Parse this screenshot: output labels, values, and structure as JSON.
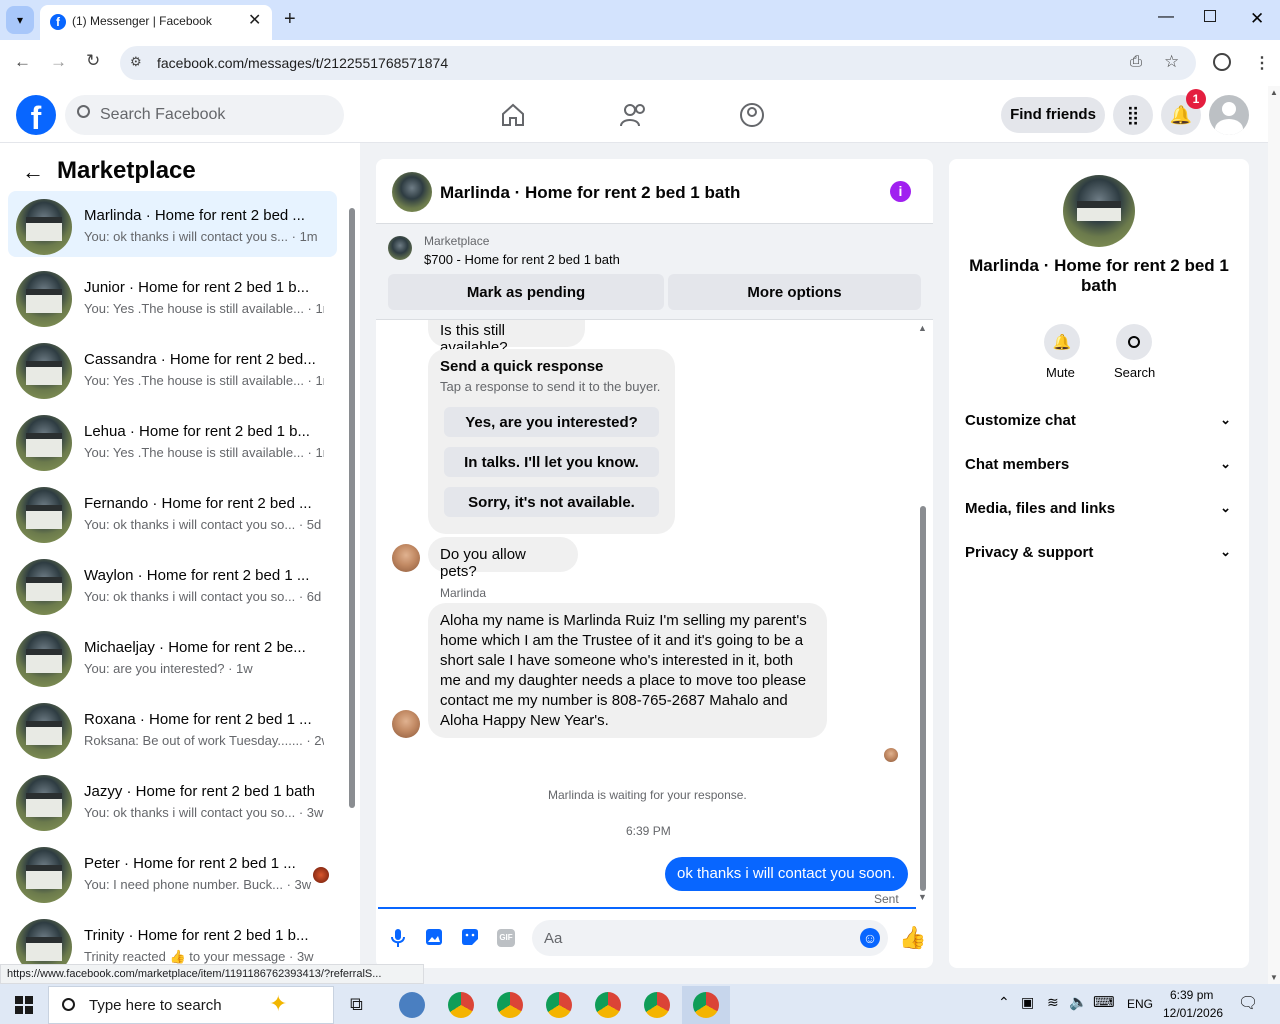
{
  "browser": {
    "tab_title": "(1) Messenger | Facebook",
    "url": "facebook.com/messages/t/2122551768571874",
    "status_url": "https://www.facebook.com/marketplace/item/1191186762393413/?referralS..."
  },
  "header": {
    "search_placeholder": "Search Facebook",
    "find_friends": "Find friends",
    "notif_count": "1"
  },
  "left": {
    "title": "Marketplace",
    "rows": [
      {
        "name": "Marlinda · Home for rent 2 bed ...",
        "sub": "You: ok thanks i will contact you s... · 1m"
      },
      {
        "name": "Junior · Home for rent 2 bed 1 b...",
        "sub": "You: Yes .The house is still available... · 1m"
      },
      {
        "name": "Cassandra · Home for rent 2 bed...",
        "sub": "You: Yes .The house is still available... · 1m"
      },
      {
        "name": "Lehua · Home for rent 2 bed 1 b...",
        "sub": "You: Yes .The house is still available... · 1m"
      },
      {
        "name": "Fernando · Home for rent 2 bed ...",
        "sub": "You: ok thanks i will contact you so... · 5d"
      },
      {
        "name": "Waylon · Home for rent 2 bed 1 ...",
        "sub": "You: ok thanks i will contact you so... · 6d"
      },
      {
        "name": "Michaeljay · Home for rent 2 be...",
        "sub": "You: are you interested? · 1w"
      },
      {
        "name": "Roxana · Home for rent 2 bed 1 ...",
        "sub": "Roksana: Be out of work Tuesday....... · 2w"
      },
      {
        "name": "Jazyy · Home for rent 2 bed 1 bath",
        "sub": "You: ok thanks i will contact you so... · 3w"
      },
      {
        "name": "Peter · Home for rent 2 bed 1 ...",
        "sub": "You: I need phone number. Buck... · 3w"
      },
      {
        "name": "Trinity · Home for rent 2 bed 1 b...",
        "sub": "Trinity reacted 👍 to your message · 3w"
      }
    ]
  },
  "chat": {
    "title": "Marlinda · Home for rent 2 bed 1 bath",
    "listing_source": "Marketplace",
    "listing_desc": "$700 - Home for rent 2 bed 1 bath",
    "mark_pending": "Mark as pending",
    "more_options": "More options",
    "msg_available": "Is this still available?",
    "quick_title": "Send a quick response",
    "quick_sub": "Tap a response to send it to the buyer.",
    "quick_1": "Yes, are you interested?",
    "quick_2": "In talks. I'll let you know.",
    "quick_3": "Sorry, it's not available.",
    "msg_pets": "Do you allow pets?",
    "sender": "Marlinda",
    "msg_long": "Aloha my name is Marlinda Ruiz I'm selling my parent's home which I am the Trustee of it and it's going to be a short sale I have someone who's interested in it,  both me and my daughter needs a place to move too please contact me my number is 808-765-2687 Mahalo and Aloha Happy New Year's.",
    "waiting": "Marlinda is waiting for your response.",
    "time": "6:39 PM",
    "my_msg": "ok thanks i will contact you soon.",
    "sent": "Sent",
    "input_placeholder": "Aa"
  },
  "right": {
    "title": "Marlinda · Home for rent 2 bed 1 bath",
    "mute": "Mute",
    "search": "Search",
    "acc": [
      "Customize chat",
      "Chat members",
      "Media, files and links",
      "Privacy & support"
    ]
  },
  "taskbar": {
    "search_placeholder": "Type here to search",
    "lang": "ENG",
    "time": "6:39 pm",
    "date": "12/01/2026"
  }
}
